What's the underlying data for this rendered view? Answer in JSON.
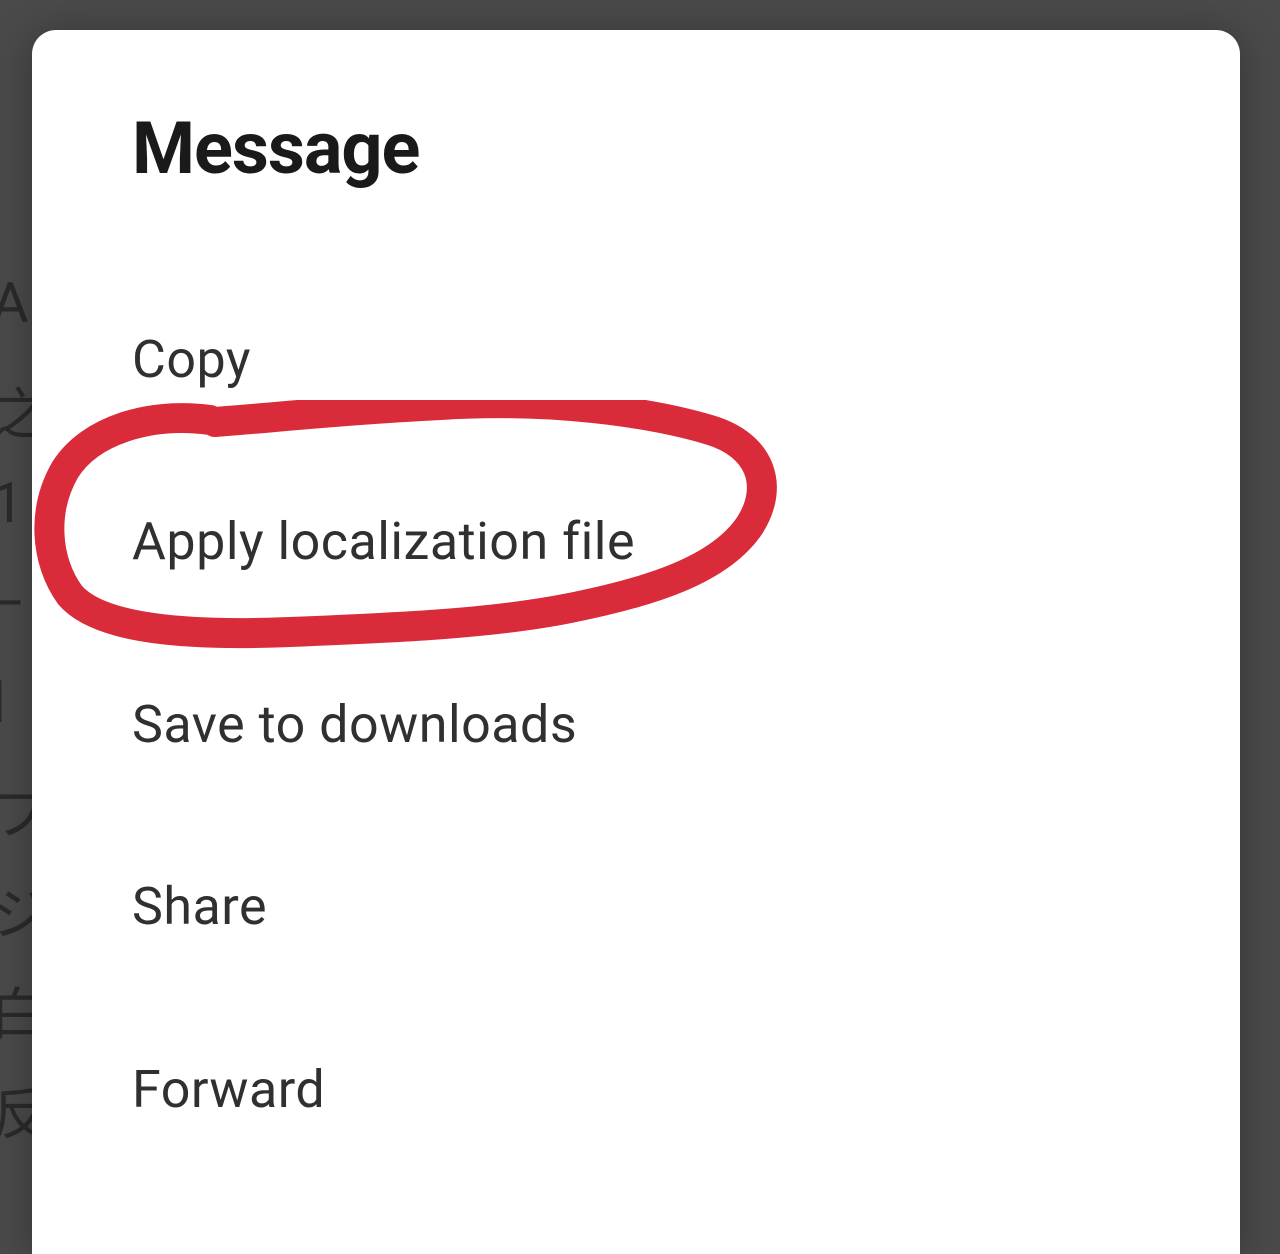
{
  "dialog": {
    "title": "Message",
    "menu_items": [
      {
        "label": "Copy"
      },
      {
        "label": "Apply localization file"
      },
      {
        "label": "Save to downloads"
      },
      {
        "label": "Share"
      },
      {
        "label": "Forward"
      }
    ]
  },
  "annotation": {
    "highlighted_item_index": 1,
    "color": "#d92b3a"
  }
}
